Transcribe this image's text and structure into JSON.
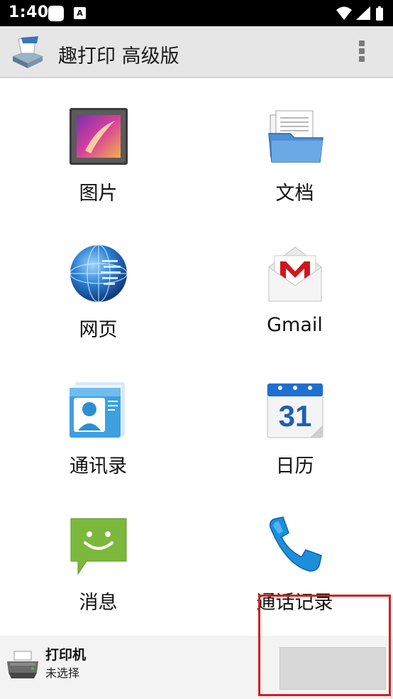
{
  "status_bar": {
    "time": "1:40",
    "notification_a": "A",
    "icons": [
      "square-notification-icon",
      "a-notification-icon",
      "wifi-icon",
      "signal-icon",
      "battery-icon"
    ]
  },
  "app_bar": {
    "title": "趣打印 高级版",
    "icons": [
      "printer-logo-icon",
      "overflow-menu-icon"
    ]
  },
  "grid": {
    "items": [
      {
        "label": "图片",
        "icon": "pictures-icon"
      },
      {
        "label": "文档",
        "icon": "documents-folder-icon"
      },
      {
        "label": "网页",
        "icon": "globe-icon"
      },
      {
        "label": "Gmail",
        "icon": "gmail-icon"
      },
      {
        "label": "通讯录",
        "icon": "contacts-icon"
      },
      {
        "label": "日历",
        "icon": "calendar-icon"
      },
      {
        "label": "消息",
        "icon": "message-icon"
      },
      {
        "label": "通话记录",
        "icon": "phone-icon"
      }
    ],
    "calendar_day": "31"
  },
  "bottom_bar": {
    "title": "打印机",
    "subtitle": "未选择"
  },
  "colors": {
    "highlight": "#d21f1f",
    "app_bar_bg": "#e6e6e6",
    "bottom_bar_bg": "#f3f3f3"
  }
}
